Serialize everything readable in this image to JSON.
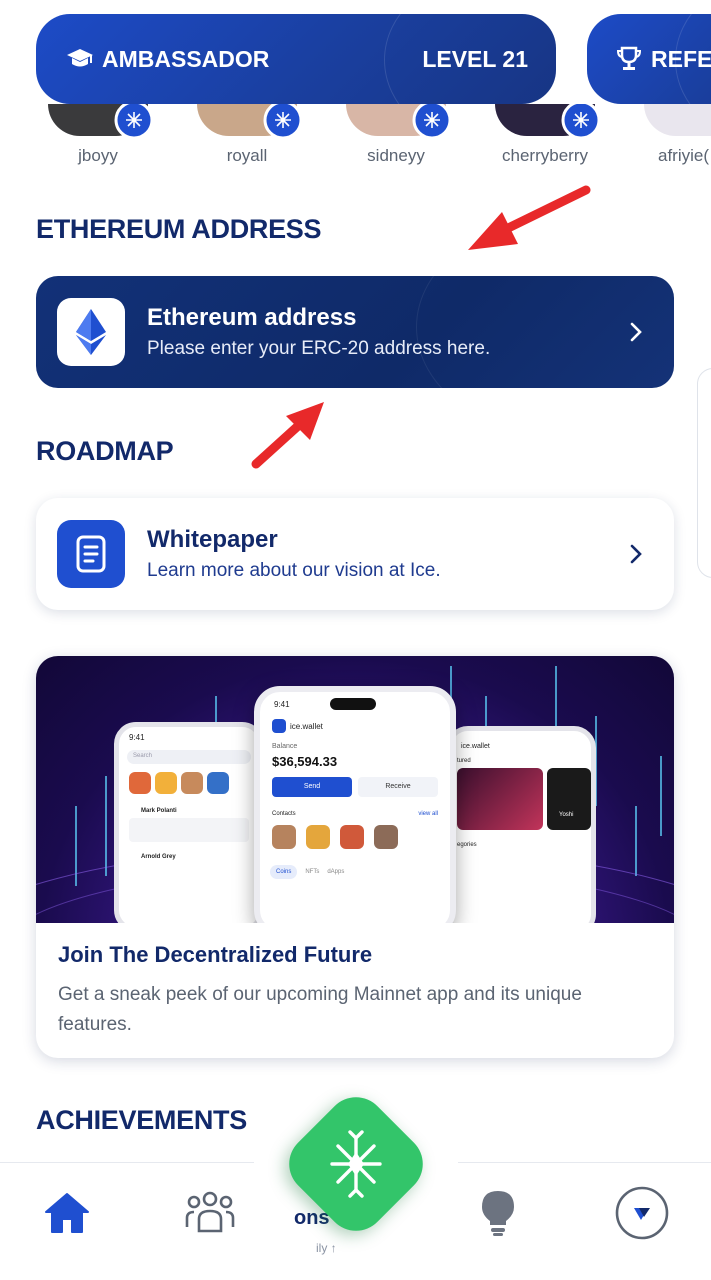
{
  "badges": {
    "ambassador_label": "AMBASSADOR",
    "level_label": "LEVEL 21",
    "referrals_label": "REFER"
  },
  "avatars": [
    {
      "name": "jboyy"
    },
    {
      "name": "royall"
    },
    {
      "name": "sidneyy"
    },
    {
      "name": "cherryberry"
    },
    {
      "name": "afriyie("
    }
  ],
  "sections": {
    "ethereum": "ETHEREUM ADDRESS",
    "roadmap": "ROADMAP",
    "achievements": "ACHIEVEMENTS"
  },
  "eth_card": {
    "title": "Ethereum address",
    "subtitle": "Please enter your ERC-20 address here."
  },
  "whitepaper_card": {
    "title": "Whitepaper",
    "subtitle": "Learn more about our vision at Ice."
  },
  "promo": {
    "title": "Join The Decentralized Future",
    "description": "Get a sneak peek of our upcoming Mainnet app and its unique features.",
    "phone_time": "9:41",
    "wallet_name": "ice.wallet",
    "balance_label": "Balance",
    "balance_value": "$36,594.33",
    "send_label": "Send",
    "receive_label": "Receive",
    "contacts_label": "Contacts",
    "view_all": "view all",
    "tab_coins": "Coins",
    "tab_nfts": "NFTs",
    "tab_dapps": "dApps",
    "search_placeholder": "Search",
    "post_author": "Mark Polanti",
    "post_author2": "Arnold Grey",
    "featured_label": "tured",
    "categories_label": "egories",
    "nft_title": "Yoshi"
  },
  "bottom_nav": {
    "partial_label": "ons",
    "partial_sub": "ily ↑"
  },
  "colors": {
    "brand_blue": "#1f4fd0",
    "navy": "#12296a",
    "accent_green": "#33c56a",
    "arrow_red": "#e8292a"
  }
}
